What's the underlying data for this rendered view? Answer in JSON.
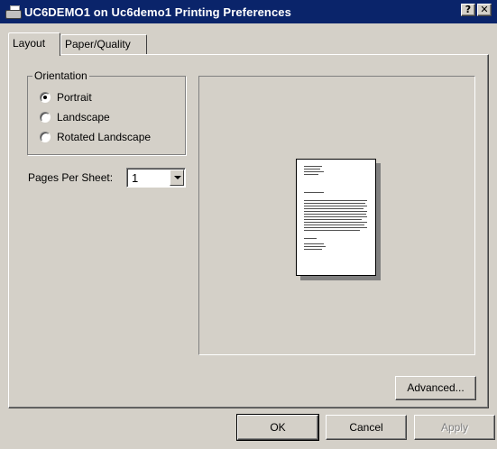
{
  "window": {
    "title": "UC6DEMO1 on Uc6demo1 Printing Preferences",
    "help_label": "?",
    "close_label": "✕"
  },
  "tabs": [
    {
      "label": "Layout",
      "selected": true
    },
    {
      "label": "Paper/Quality",
      "selected": false
    }
  ],
  "orientation": {
    "legend": "Orientation",
    "options": [
      {
        "label": "Portrait",
        "checked": true
      },
      {
        "label": "Landscape",
        "checked": false
      },
      {
        "label": "Rotated Landscape",
        "checked": false
      }
    ]
  },
  "pages_per_sheet": {
    "label": "Pages Per Sheet:",
    "value": "1"
  },
  "buttons": {
    "advanced": "Advanced...",
    "ok": "OK",
    "cancel": "Cancel",
    "apply": "Apply"
  },
  "colors": {
    "titlebar": "#0a246a",
    "face": "#d4d0c8"
  }
}
